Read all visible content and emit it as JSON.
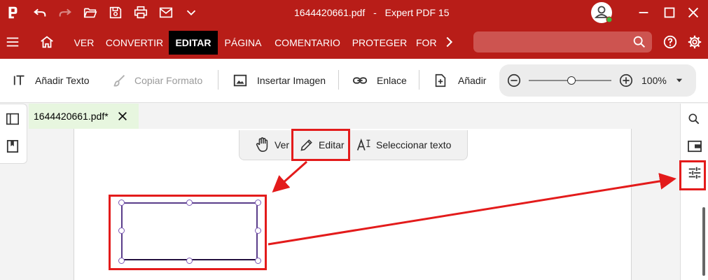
{
  "titlebar": {
    "filename": "1644420661.pdf",
    "separator": "-",
    "app_name": "Expert PDF 15"
  },
  "menu": {
    "tabs": [
      "VER",
      "CONVERTIR",
      "EDITAR",
      "PÁGINA",
      "COMENTARIO",
      "PROTEGER",
      "FOR"
    ],
    "active_index": 2,
    "search_placeholder": ""
  },
  "toolbar": {
    "add_text": "Añadir Texto",
    "copy_format": "Copiar Formato",
    "insert_image": "Insertar Imagen",
    "link": "Enlace",
    "add": "Añadir",
    "zoom_level": "100%"
  },
  "document": {
    "tab_name": "1644420661.pdf*"
  },
  "modes": {
    "view": "Ver",
    "edit": "Editar",
    "select_text": "Seleccionar texto"
  },
  "colors": {
    "brand_red": "#b81d18",
    "annotation_red": "#e31b1b",
    "doc_tab_green": "#e7f6df"
  }
}
